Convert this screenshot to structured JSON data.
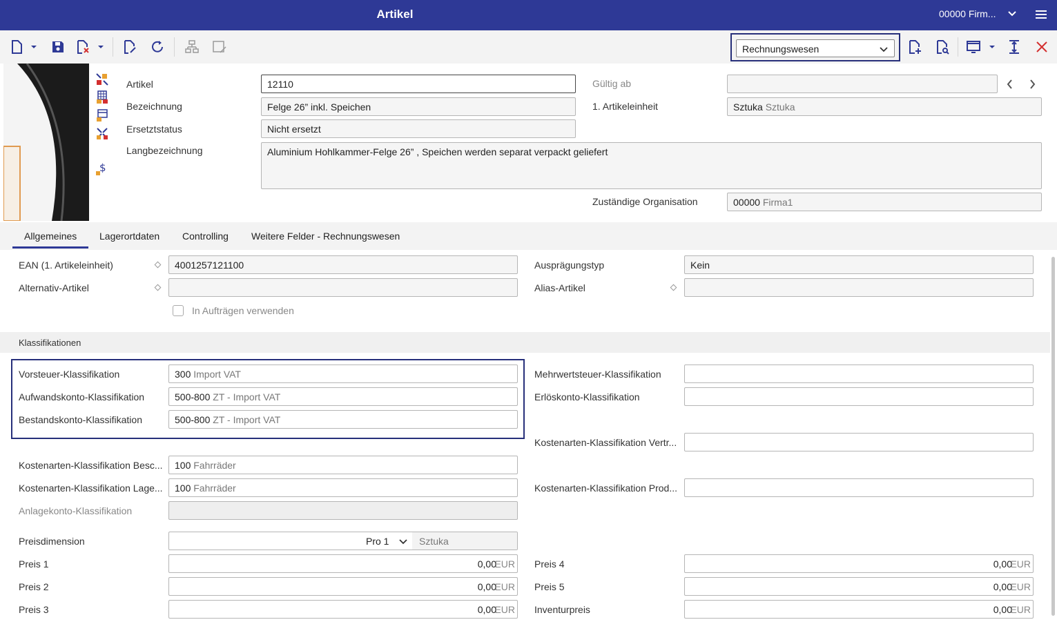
{
  "header": {
    "title": "Artikel",
    "company": "00000 Firm..."
  },
  "toolbar": {
    "view_select": "Rechnungswesen"
  },
  "article": {
    "artikel_label": "Artikel",
    "artikel_value": "12110",
    "bezeichnung_label": "Bezeichnung",
    "bezeichnung_value": "Felge  26” inkl. Speichen",
    "ersetztstatus_label": "Ersetztstatus",
    "ersetztstatus_value": "Nicht ersetzt",
    "langbezeichnung_label": "Langbezeichnung",
    "langbezeichnung_value": "Aluminium Hohlkammer-Felge  26” , Speichen werden separat verpackt geliefert",
    "gueltig_label": "Gültig ab",
    "gueltig_value": "",
    "einheit_label": "1. Artikeleinheit",
    "einheit_code": "Sztuka",
    "einheit_desc": "Sztuka",
    "org_label": "Zuständige Organisation",
    "org_code": "00000",
    "org_desc": "Firma1"
  },
  "tabs": [
    "Allgemeines",
    "Lagerortdaten",
    "Controlling",
    "Weitere Felder - Rechnungswesen"
  ],
  "general": {
    "ean_label": "EAN (1. Artikeleinheit)",
    "ean_value": "4001257121100",
    "alt_label": "Alternativ-Artikel",
    "alt_value": "",
    "auftraege_label": "In Aufträgen verwenden",
    "auspraegung_label": "Ausprägungstyp",
    "auspraegung_value": "Kein",
    "alias_label": "Alias-Artikel",
    "alias_value": ""
  },
  "klass": {
    "section_title": "Klassifikationen",
    "vorsteuer_label": "Vorsteuer-Klassifikation",
    "vorsteuer_code": "300",
    "vorsteuer_desc": "Import VAT",
    "aufwand_label": "Aufwandskonto-Klassifikation",
    "aufwand_code": "500-800",
    "aufwand_desc": "ZT - Import VAT",
    "bestand_label": "Bestandskonto-Klassifikation",
    "bestand_code": "500-800",
    "bestand_desc": "ZT - Import VAT",
    "mwst_label": "Mehrwertsteuer-Klassifikation",
    "erloes_label": "Erlöskonto-Klassifikation",
    "kost_vertr_label": "Kostenarten-Klassifikation Vertr...",
    "kost_besc_label": "Kostenarten-Klassifikation Besc...",
    "kost_besc_code": "100",
    "kost_besc_desc": "Fahrräder",
    "kost_lage_label": "Kostenarten-Klassifikation Lage...",
    "kost_lage_code": "100",
    "kost_lage_desc": "Fahrräder",
    "kost_prod_label": "Kostenarten-Klassifikation Prod...",
    "anlage_label": "Anlagekonto-Klassifikation"
  },
  "prices": {
    "dim_label": "Preisdimension",
    "dim_value": "Pro 1",
    "dim_unit": "Sztuka",
    "p1_label": "Preis 1",
    "p1_value": "0,00",
    "p2_label": "Preis 2",
    "p2_value": "0,00",
    "p3_label": "Preis 3",
    "p3_value": "0,00",
    "p4_label": "Preis 4",
    "p4_value": "0,00",
    "p5_label": "Preis 5",
    "p5_value": "0,00",
    "inv_label": "Inventurpreis",
    "inv_value": "0,00",
    "currency": "EUR"
  }
}
